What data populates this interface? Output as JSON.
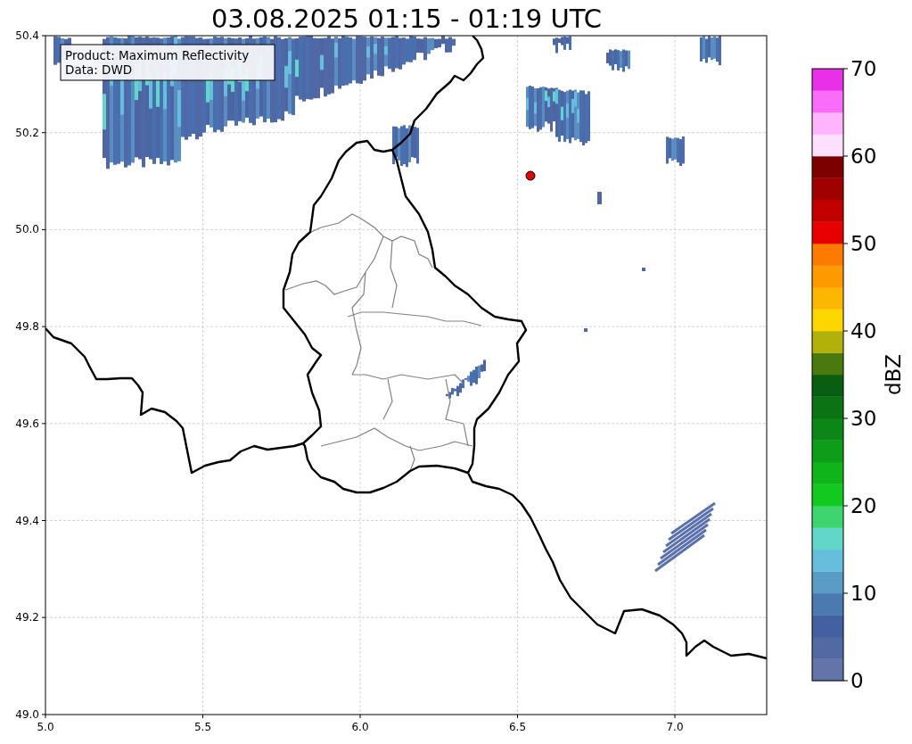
{
  "title": "03.08.2025 01:15 - 01:19 UTC",
  "info_box": [
    "Product: Maximum Reflectivity",
    "Data: DWD"
  ],
  "x_ticks": [
    "5.0",
    "5.5",
    "6.0",
    "6.5",
    "7.0"
  ],
  "y_ticks": [
    "50.4",
    "50.2",
    "50.0",
    "49.8",
    "49.6",
    "49.4",
    "49.2",
    "49.0"
  ],
  "colorbar": {
    "label": "dBZ",
    "ticks": [
      "70",
      "60",
      "50",
      "40",
      "30",
      "20",
      "10",
      "0"
    ],
    "bands": [
      {
        "color": "#6374a8"
      },
      {
        "color": "#526aa3"
      },
      {
        "color": "#4361a0"
      },
      {
        "color": "#4b7ab0"
      },
      {
        "color": "#5a9cc6"
      },
      {
        "color": "#66bddc"
      },
      {
        "color": "#62d6c8"
      },
      {
        "color": "#3ed470"
      },
      {
        "color": "#11c91f"
      },
      {
        "color": "#0fb31a"
      },
      {
        "color": "#0e9d18"
      },
      {
        "color": "#0c8715"
      },
      {
        "color": "#0b7313"
      },
      {
        "color": "#095e11"
      },
      {
        "color": "#4a7a0f"
      },
      {
        "color": "#b2b00a"
      },
      {
        "color": "#fdd600"
      },
      {
        "color": "#fdb700"
      },
      {
        "color": "#fd9a00"
      },
      {
        "color": "#fd7a00"
      },
      {
        "color": "#e60000"
      },
      {
        "color": "#c30000"
      },
      {
        "color": "#a00000"
      },
      {
        "color": "#7d0000"
      },
      {
        "color": "#ffe0fe"
      },
      {
        "color": "#ffb4fc"
      },
      {
        "color": "#fb6cf8"
      },
      {
        "color": "#e930e8"
      }
    ]
  }
}
